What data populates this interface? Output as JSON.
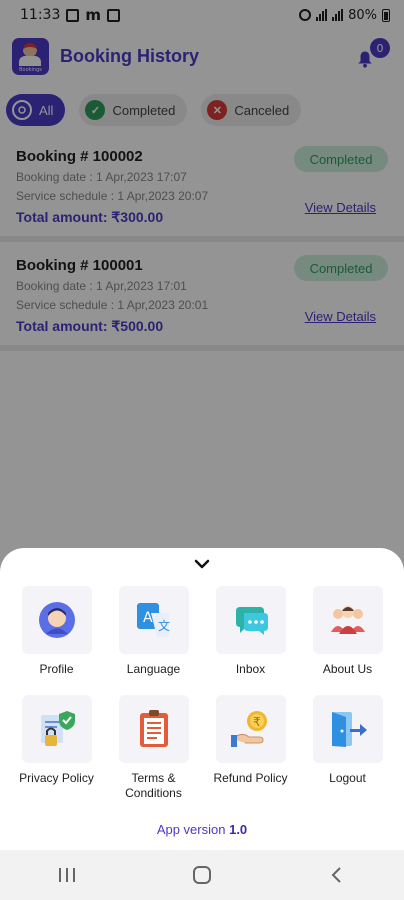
{
  "status_bar": {
    "time": "11:33",
    "notif_letter": "m",
    "battery": "80%"
  },
  "header": {
    "title": "Booking History",
    "logo_text": "Bookings",
    "notification_count": "0"
  },
  "filters": [
    {
      "label": "All",
      "icon": "all-filter-icon",
      "active": true
    },
    {
      "label": "Completed",
      "icon": "check-circle-icon",
      "active": false
    },
    {
      "label": "Canceled",
      "icon": "cross-circle-icon",
      "active": false
    }
  ],
  "bookings": [
    {
      "title": "Booking # 100002",
      "booking_date": "Booking date : 1 Apr,2023 17:07",
      "service_schedule": "Service schedule : 1 Apr,2023 20:07",
      "total": "Total amount: ₹300.00",
      "status": "Completed",
      "action": "View Details"
    },
    {
      "title": "Booking # 100001",
      "booking_date": "Booking date : 1 Apr,2023 17:01",
      "service_schedule": "Service schedule : 1 Apr,2023 20:01",
      "total": "Total amount: ₹500.00",
      "status": "Completed",
      "action": "View Details"
    }
  ],
  "menu": [
    {
      "label": "Profile",
      "icon": "profile-icon"
    },
    {
      "label": "Language",
      "icon": "language-icon"
    },
    {
      "label": "Inbox",
      "icon": "inbox-icon"
    },
    {
      "label": "About Us",
      "icon": "about-us-icon"
    },
    {
      "label": "Privacy Policy",
      "icon": "privacy-policy-icon"
    },
    {
      "label": "Terms & Conditions",
      "icon": "terms-icon"
    },
    {
      "label": "Refund Policy",
      "icon": "refund-policy-icon"
    },
    {
      "label": "Logout",
      "icon": "logout-icon"
    }
  ],
  "app_version": {
    "label": "App version",
    "value": "1.0"
  },
  "colors": {
    "accent": "#4a3bc7",
    "success": "#2e9e5c",
    "danger": "#d83a3a"
  }
}
